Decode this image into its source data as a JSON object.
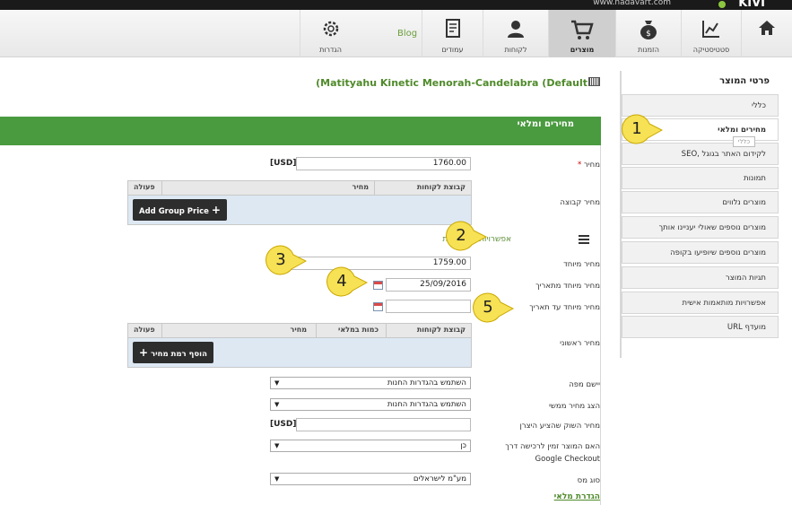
{
  "topbar": {
    "url": "www.nadavart.com",
    "logo": "KIVI"
  },
  "nav": {
    "items": [
      {
        "label": "",
        "icon": "home-icon"
      },
      {
        "label": "סטטיסטיקה",
        "icon": "chart-icon"
      },
      {
        "label": "הזמנות",
        "icon": "money-bag-icon"
      },
      {
        "label": "מוצרים",
        "icon": "cart-icon"
      },
      {
        "label": "לקוחות",
        "icon": "user-icon"
      },
      {
        "label": "עמודים",
        "icon": "page-icon"
      },
      {
        "label": "הגדרות",
        "icon": "gear-icon"
      }
    ],
    "blog": "Blog"
  },
  "sidebar": {
    "title": "פרטי המוצר",
    "items": [
      "כללי",
      "מחירים ומלאי",
      "SEO, לקידום האתר בגוגל",
      "תמונות",
      "מוצרים נלווים",
      "מוצרים נוספים שאולי יעניינו אותך",
      "מוצרים נוספים שיופיעו בקופה",
      "תגיות המוצר",
      "אפשרויות מותאמות אישית",
      "URL מועדף"
    ],
    "tooltip": "כללי"
  },
  "product": {
    "title": "(Matityahu Kinetic Menorah-Candelabra (Default"
  },
  "section": {
    "title": "מחירים ומלאי"
  },
  "form": {
    "price_label": "מחיר",
    "price_required": "*",
    "price_value": "1760.00",
    "currency": "[USD]",
    "group_price_label": "מחיר קבוצה",
    "group_table": {
      "col_group": "קבוצת לקוחות",
      "col_price": "מחיר",
      "col_action": "פעולה",
      "button": "Add Group Price"
    },
    "advanced_link": "אפשרויות מתקדמות",
    "special_price_label": "מחיר מיוחד",
    "special_price_value": "1759.00",
    "special_from_label": "מחיר מיוחד מתאריך",
    "special_from_value": "25/09/2016",
    "special_to_label": "מחיר מיוחד עד תאריך",
    "special_to_value": "",
    "tier_price_label": "מחיר ראשוני",
    "tier_table": {
      "col_group": "קבוצת לקוחות",
      "col_qty": "כמות במלאי",
      "col_price": "מחיר",
      "col_action": "פעולה",
      "button": "הוסף רמת מחיר"
    },
    "map_label": "יישם מפה",
    "map_value": "השתמש בהגדרות החנות",
    "actual_price_label": "הצג מחיר ממשי",
    "actual_price_value": "השתמש בהגדרות החנות",
    "msrp_label": "מחיר השוק שהציע היצרן",
    "msrp_currency": "[USD]",
    "google_checkout_label_1": "האם המוצר זמין לרכישה דרך",
    "google_checkout_label_2": "Google Checkout",
    "google_checkout_value": "כן",
    "tax_label": "סוג מס",
    "tax_value": "מע\"מ לישראלים",
    "stock_link": "הגדרת מלאי"
  },
  "callouts": [
    "1",
    "2",
    "3",
    "4",
    "5"
  ],
  "colors": {
    "accent_green": "#4a9a3f",
    "callout_yellow": "#f7e154"
  }
}
